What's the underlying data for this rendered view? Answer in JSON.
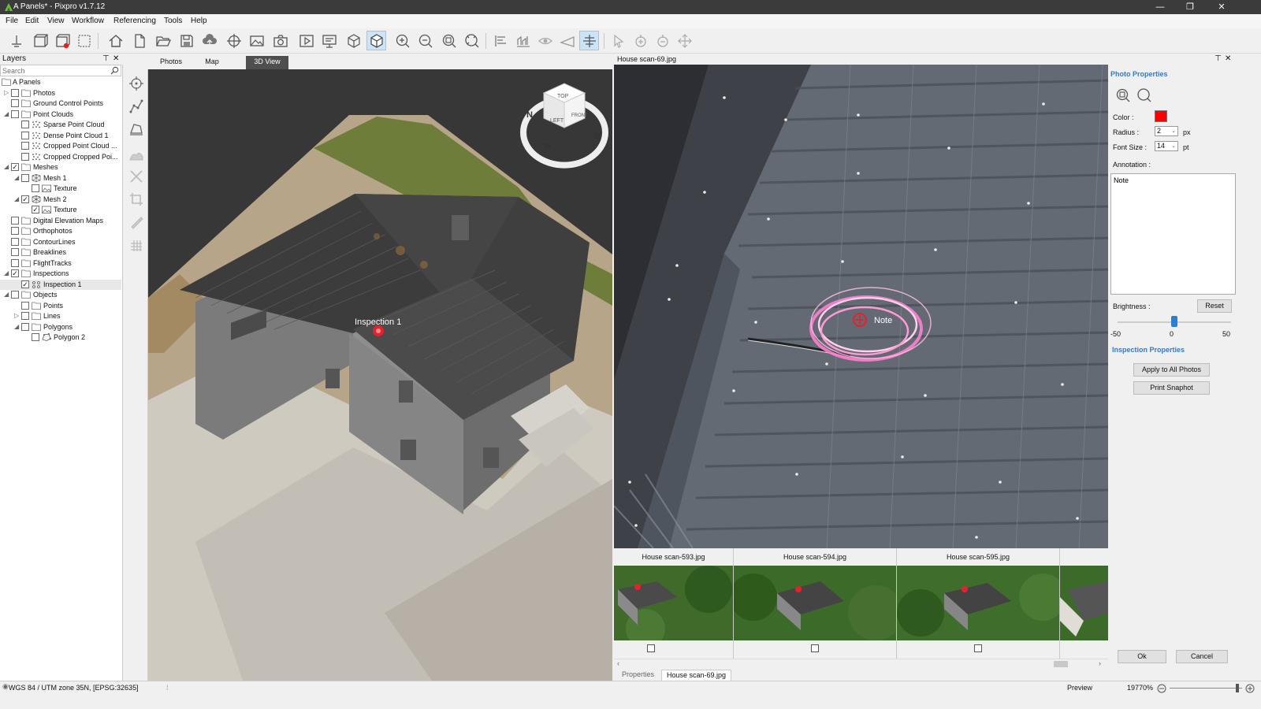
{
  "window": {
    "title": "A Panels* - Pixpro v1.7.12"
  },
  "menu": [
    "File",
    "Edit",
    "View",
    "Workflow",
    "Referencing",
    "Tools",
    "Help"
  ],
  "layers": {
    "title": "Layers",
    "search_placeholder": "Search",
    "root": "A Panels",
    "items": [
      {
        "label": "Photos",
        "level": 1,
        "expander": "collapsed",
        "checked": false,
        "icon": "folder-icon"
      },
      {
        "label": "Ground Control Points",
        "level": 1,
        "expander": "none",
        "checked": false,
        "icon": "folder-icon"
      },
      {
        "label": "Point Clouds",
        "level": 1,
        "expander": "expanded",
        "checked": false,
        "icon": "folder-icon"
      },
      {
        "label": "Sparse Point Cloud",
        "level": 2,
        "expander": "none",
        "checked": false,
        "icon": "point-cloud-icon"
      },
      {
        "label": "Dense Point Cloud 1",
        "level": 2,
        "expander": "none",
        "checked": false,
        "icon": "point-cloud-icon"
      },
      {
        "label": "Cropped Point Cloud ...",
        "level": 2,
        "expander": "none",
        "checked": false,
        "icon": "point-cloud-icon"
      },
      {
        "label": "Cropped Cropped Poi...",
        "level": 2,
        "expander": "none",
        "checked": false,
        "icon": "point-cloud-icon"
      },
      {
        "label": "Meshes",
        "level": 1,
        "expander": "expanded",
        "checked": true,
        "icon": "folder-icon"
      },
      {
        "label": "Mesh 1",
        "level": 2,
        "expander": "expanded",
        "checked": false,
        "icon": "mesh-icon"
      },
      {
        "label": "Texture",
        "level": 3,
        "expander": "none",
        "checked": false,
        "icon": "texture-icon"
      },
      {
        "label": "Mesh 2",
        "level": 2,
        "expander": "expanded",
        "checked": true,
        "icon": "mesh-icon"
      },
      {
        "label": "Texture",
        "level": 3,
        "expander": "none",
        "checked": true,
        "icon": "texture-icon"
      },
      {
        "label": "Digital Elevation Maps",
        "level": 1,
        "expander": "none",
        "checked": false,
        "icon": "folder-icon"
      },
      {
        "label": "Orthophotos",
        "level": 1,
        "expander": "none",
        "checked": false,
        "icon": "folder-icon"
      },
      {
        "label": "ContourLines",
        "level": 1,
        "expander": "none",
        "checked": false,
        "icon": "folder-icon"
      },
      {
        "label": "Breaklines",
        "level": 1,
        "expander": "none",
        "checked": false,
        "icon": "folder-icon"
      },
      {
        "label": "FlightTracks",
        "level": 1,
        "expander": "none",
        "checked": false,
        "icon": "folder-icon"
      },
      {
        "label": "Inspections",
        "level": 1,
        "expander": "expanded",
        "checked": true,
        "icon": "folder-icon"
      },
      {
        "label": "Inspection 1",
        "level": 2,
        "expander": "none",
        "checked": true,
        "icon": "inspection-icon"
      },
      {
        "label": "Objects",
        "level": 1,
        "expander": "expanded",
        "checked": false,
        "icon": "folder-icon"
      },
      {
        "label": "Points",
        "level": 2,
        "expander": "none",
        "checked": false,
        "icon": "folder-icon"
      },
      {
        "label": "Lines",
        "level": 2,
        "expander": "collapsed",
        "checked": false,
        "icon": "folder-icon"
      },
      {
        "label": "Polygons",
        "level": 2,
        "expander": "expanded",
        "checked": false,
        "icon": "folder-icon"
      },
      {
        "label": "Polygon 2",
        "level": 3,
        "expander": "none",
        "checked": false,
        "icon": "polygon-icon"
      }
    ]
  },
  "view_tabs": [
    "Photos",
    "Map",
    "3D View"
  ],
  "view3d": {
    "annotation": "Inspection 1",
    "cube_faces": {
      "top": "TOP",
      "left": "LEFT",
      "front": "FRONT"
    },
    "compass": {
      "n": "N",
      "s": "S",
      "w": "W"
    }
  },
  "photo": {
    "title": "House scan-69.jpg",
    "annotation": "Note"
  },
  "properties": {
    "photo_title": "Photo Properties",
    "color_label": "Color :",
    "color_value": "#ff0000",
    "radius_label": "Radius :",
    "radius_value": "2",
    "radius_unit": "px",
    "font_label": "Font Size :",
    "font_value": "14",
    "font_unit": "pt",
    "annotation_label": "Annotation :",
    "annotation_value": "Note",
    "brightness_label": "Brightness :",
    "reset": "Reset",
    "brightness_min": "-50",
    "brightness_mid": "0",
    "brightness_max": "50",
    "brightness_value": 0,
    "inspection_title": "Inspection Properties",
    "apply_all": "Apply to All Photos",
    "print_snapshot": "Print Snaphot",
    "ok": "Ok",
    "cancel": "Cancel"
  },
  "thumbnails": [
    {
      "name": "House scan-593.jpg"
    },
    {
      "name": "House scan-594.jpg"
    },
    {
      "name": "House scan-595.jpg"
    }
  ],
  "bottom_tabs": [
    "Properties",
    "House scan-69.jpg"
  ],
  "status": {
    "crs": "WGS 84 / UTM zone 35N, [EPSG:32635]",
    "preview": "Preview",
    "zoom": "19770%"
  },
  "colors": {
    "accent": "#3a78c3",
    "marker": "#e8202a",
    "active_tab": "#4f4f4f"
  }
}
